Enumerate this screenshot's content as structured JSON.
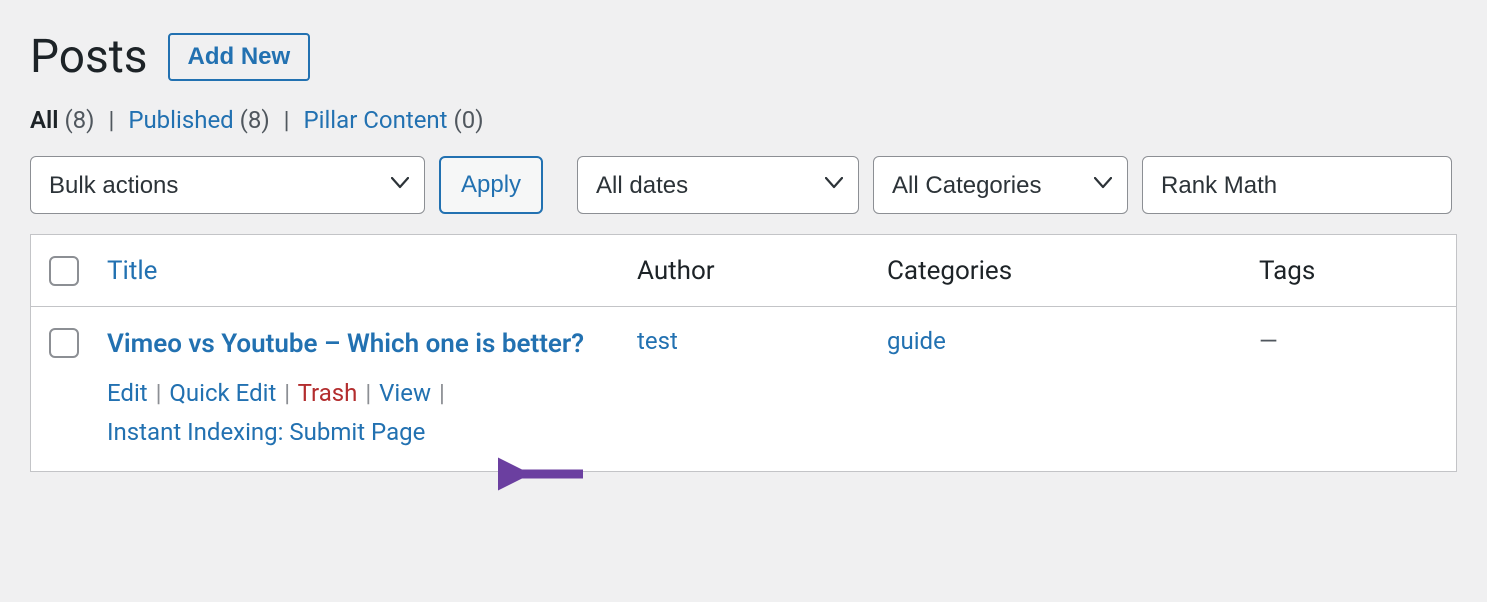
{
  "header": {
    "title": "Posts",
    "add_new": "Add New"
  },
  "filters": {
    "all": {
      "label": "All",
      "count": "(8)"
    },
    "published": {
      "label": "Published",
      "count": "(8)"
    },
    "pillar": {
      "label": "Pillar Content",
      "count": "(0)"
    }
  },
  "controls": {
    "bulk_actions": "Bulk actions",
    "apply": "Apply",
    "all_dates": "All dates",
    "all_categories": "All Categories",
    "rank_math": "Rank Math"
  },
  "columns": {
    "title": "Title",
    "author": "Author",
    "categories": "Categories",
    "tags": "Tags"
  },
  "rows": [
    {
      "title": "Vimeo vs Youtube – Which one is better?",
      "author": "test",
      "categories": "guide",
      "tags": "—",
      "actions": {
        "edit": "Edit",
        "quick_edit": "Quick Edit",
        "trash": "Trash",
        "view": "View",
        "instant_indexing": "Instant Indexing: Submit Page"
      }
    }
  ]
}
